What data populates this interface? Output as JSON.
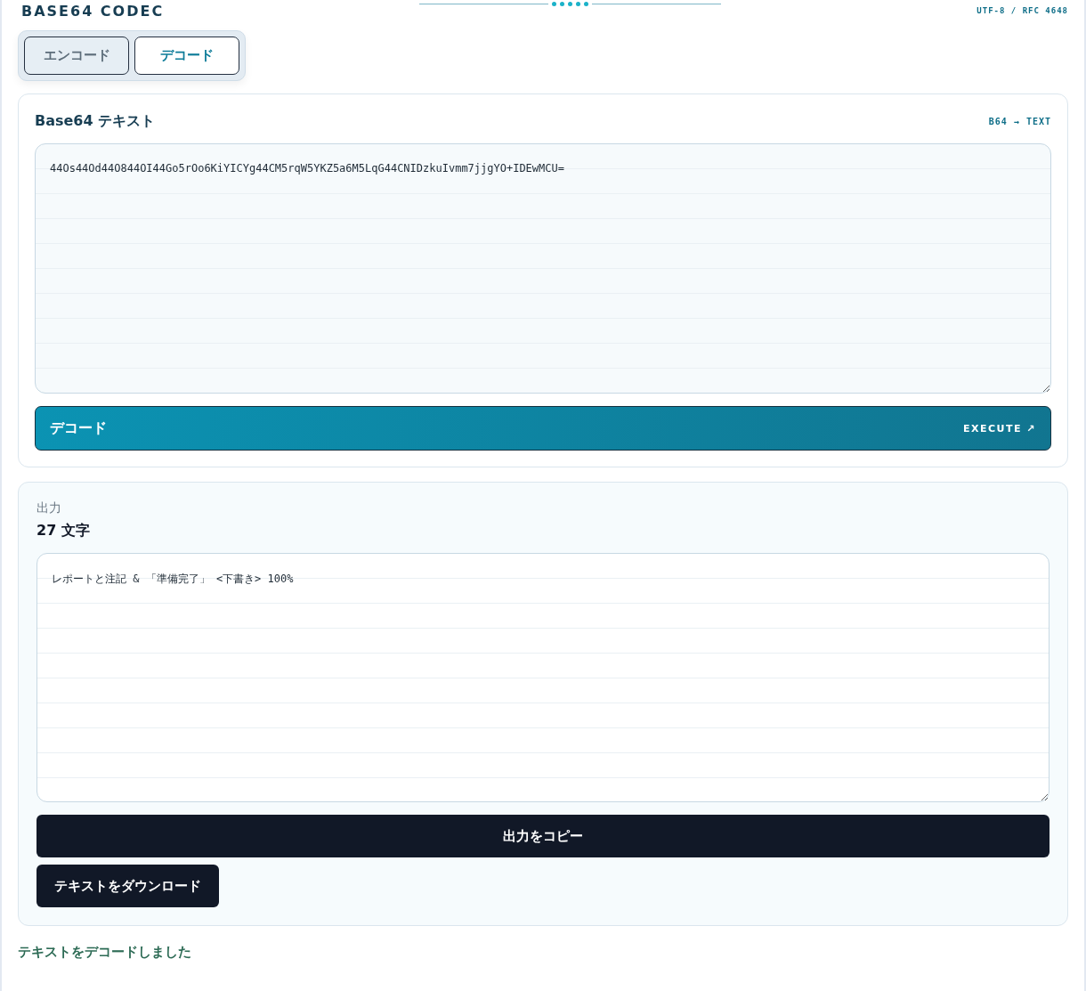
{
  "header": {
    "title": "BASE64 CODEC",
    "standard": "UTF-8 / RFC 4648"
  },
  "tabs": [
    {
      "label": "エンコード",
      "selected": false
    },
    {
      "label": "デコード",
      "selected": true
    }
  ],
  "input_panel": {
    "title": "Base64 テキスト",
    "direction": "B64 → TEXT",
    "value": "44Os44Od44O844OI44Go5rOo6KiYICYg44CM5rqW5YKZ5a6M5LqG44CNIDzkuIvmm7jjgYO+IDEwMCU=",
    "action": {
      "label": "デコード",
      "hint": "EXECUTE ↗"
    }
  },
  "output_panel": {
    "label": "出力",
    "count": "27 文字",
    "value": "レポートと注記 & 「準備完了」 <下書き> 100%",
    "buttons": [
      {
        "label": "出力をコピー",
        "kind": "wide"
      },
      {
        "label": "テキストをダウンロード",
        "kind": "compact"
      }
    ]
  },
  "status": "テキストをデコードしました"
}
